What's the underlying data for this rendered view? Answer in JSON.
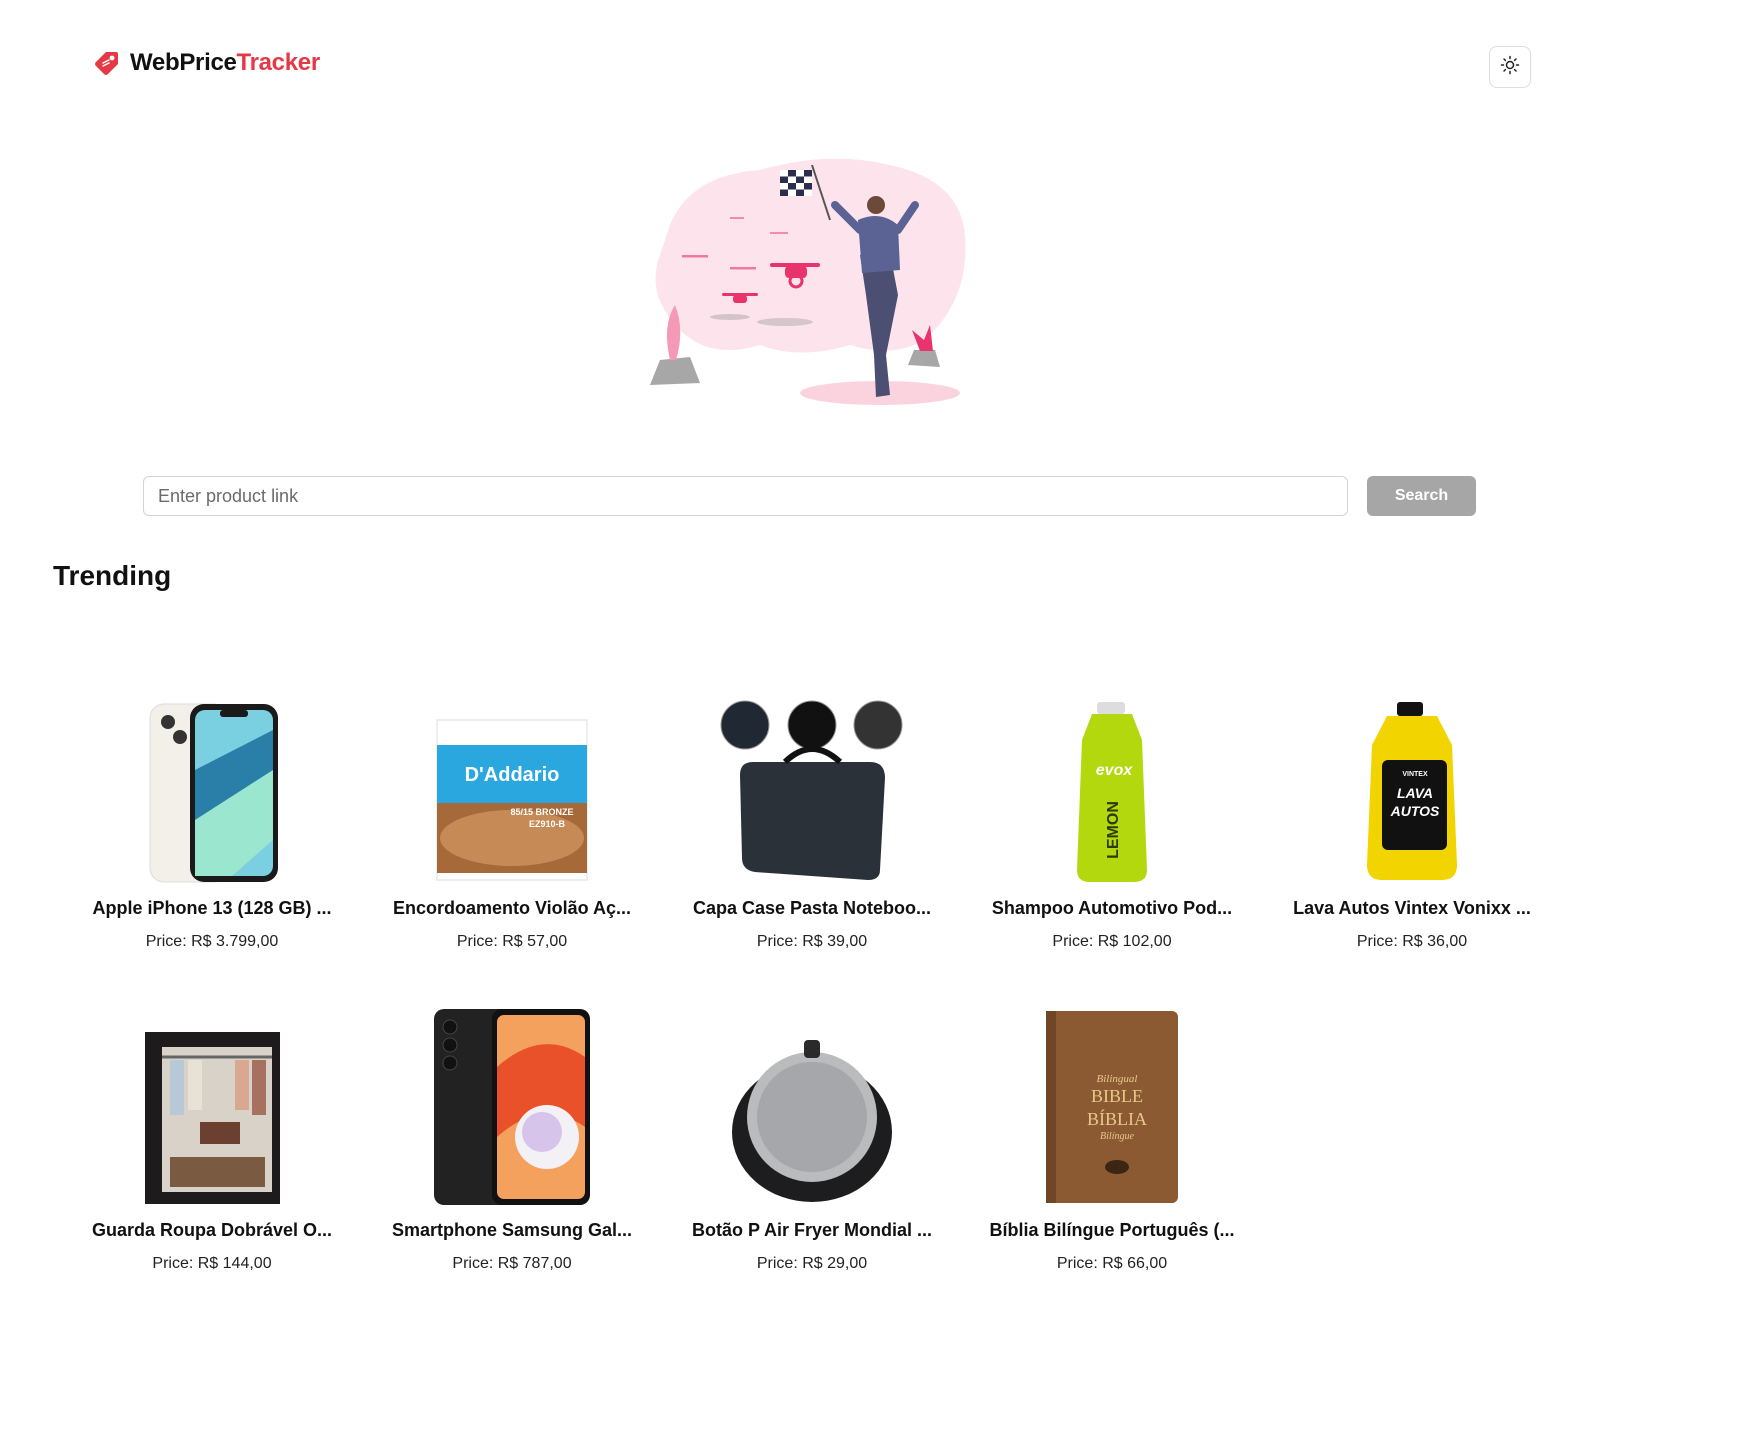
{
  "header": {
    "brand_first": "WebPrice",
    "brand_second": "Tracker",
    "brand_icon": "price-tag-icon",
    "theme_toggle_icon": "sun-icon",
    "accent_color": "#e63946"
  },
  "search": {
    "placeholder": "Enter product link",
    "value": "",
    "button_label": "Search",
    "button_color": "#a6a6a6"
  },
  "trending": {
    "title": "Trending",
    "items": [
      {
        "title": "Apple iPhone 13 (128 GB) ...",
        "price": "Price: R$ 3.799,00",
        "image": "iphone-image"
      },
      {
        "title": "Encordoamento Violão Aç...",
        "price": "Price: R$ 57,00",
        "image": "guitar-strings-image"
      },
      {
        "title": "Capa Case Pasta Noteboo...",
        "price": "Price: R$ 39,00",
        "image": "laptop-case-image"
      },
      {
        "title": "Shampoo Automotivo Pod...",
        "price": "Price: R$ 102,00",
        "image": "lemon-shampoo-image"
      },
      {
        "title": "Lava Autos Vintex Vonixx ...",
        "price": "Price: R$ 36,00",
        "image": "car-wash-image"
      },
      {
        "title": "Guarda Roupa Dobrável O...",
        "price": "Price: R$ 144,00",
        "image": "wardrobe-image"
      },
      {
        "title": "Smartphone Samsung Gal...",
        "price": "Price: R$ 787,00",
        "image": "samsung-phone-image"
      },
      {
        "title": "Botão P Air Fryer Mondial ...",
        "price": "Price: R$ 29,00",
        "image": "air-fryer-knob-image"
      },
      {
        "title": "Bíblia Bilíngue Português (...",
        "price": "Price: R$ 66,00",
        "image": "bible-image"
      }
    ],
    "product_labels": {
      "strings_brand": "D'Addario",
      "strings_model": "85/15 BRONZE",
      "strings_code": "EZ910-B",
      "shampoo_brand": "evox",
      "shampoo_name": "LEMON",
      "carwash_brand": "VINTEX",
      "carwash_name_1": "LAVA",
      "carwash_name_2": "AUTOS",
      "bible_1": "Bilingual",
      "bible_2": "BIBLE",
      "bible_3": "BÍBLIA",
      "bible_4": "Bilíngue"
    }
  }
}
